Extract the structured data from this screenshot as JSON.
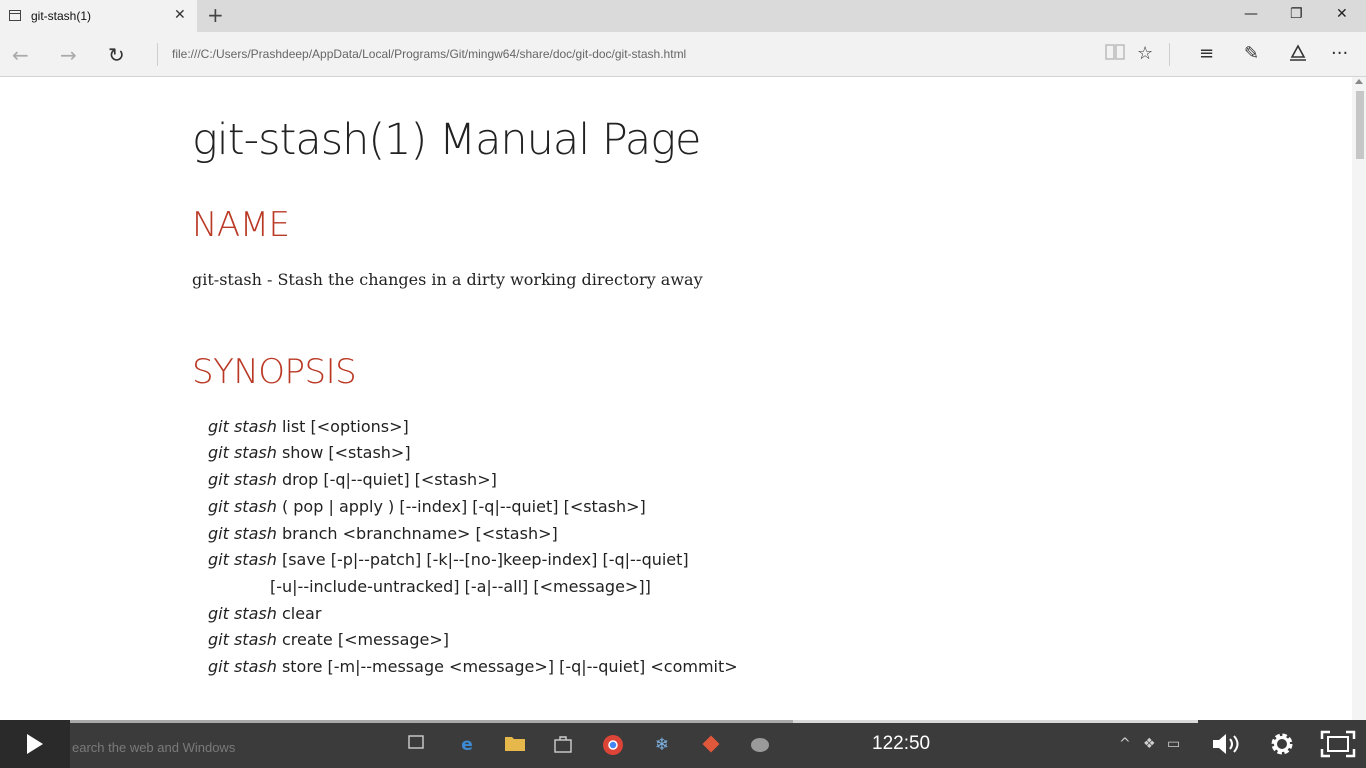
{
  "tab": {
    "title": "git-stash(1)",
    "close": "✕",
    "new_tab": "+"
  },
  "window": {
    "minimize": "—",
    "restore": "❐",
    "close": "✕"
  },
  "nav": {
    "back": "←",
    "forward": "→",
    "refresh": "↻",
    "url": "file:///C:/Users/Prashdeep/AppData/Local/Programs/Git/mingw64/share/doc/git-doc/git-stash.html",
    "reading_view": "📖",
    "favorite": "☆",
    "hub": "≡",
    "web_note": "✎",
    "share": "⇪",
    "more": "···"
  },
  "page": {
    "title": "git-stash(1) Manual Page",
    "name_heading": "NAME",
    "description": "git-stash - Stash the changes in a dirty working directory away",
    "synopsis_heading": "SYNOPSIS",
    "synopsis": [
      {
        "cmd": "git stash",
        "args": " list [<options>]"
      },
      {
        "cmd": "git stash",
        "args": " show [<stash>]"
      },
      {
        "cmd": "git stash",
        "args": " drop [-q|--quiet] [<stash>]"
      },
      {
        "cmd": "git stash",
        "args": " ( pop | apply ) [--index] [-q|--quiet] [<stash>]"
      },
      {
        "cmd": "git stash",
        "args": " branch <branchname> [<stash>]"
      },
      {
        "cmd": "git stash",
        "args": " [save [-p|--patch] [-k|--[no-]keep-index] [-q|--quiet]"
      },
      {
        "cmd": "",
        "args": "[-u|--include-untracked] [-a|--all] [<message>]]"
      },
      {
        "cmd": "git stash",
        "args": " clear"
      },
      {
        "cmd": "git stash",
        "args": " create [<message>]"
      },
      {
        "cmd": "git stash",
        "args": " store [-m|--message <message>] [-q|--quiet] <commit>"
      }
    ]
  },
  "player": {
    "search_placeholder": "earch the web and Windows",
    "time": "122:50",
    "progress": 0.6413,
    "volume_icon": "🔊",
    "settings_icon": "⚙",
    "fullscreen_icon": "⛶"
  }
}
